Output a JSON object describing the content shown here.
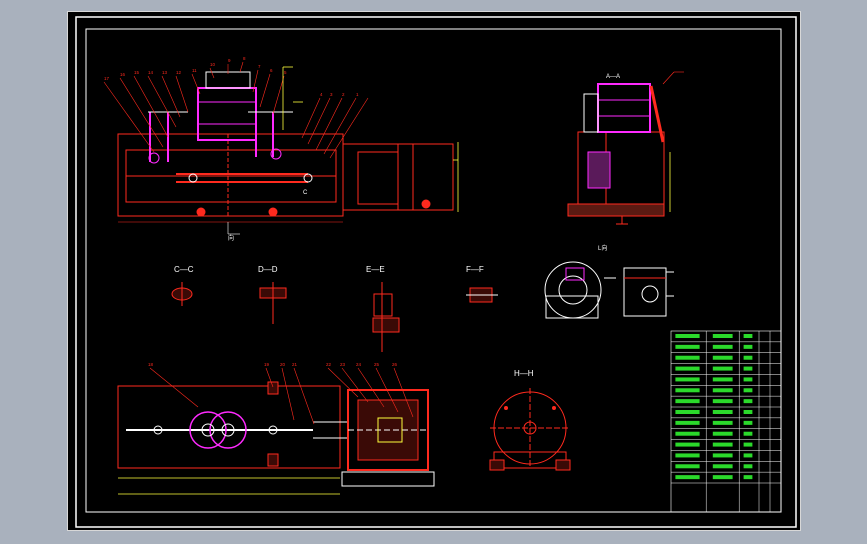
{
  "views": {
    "section_labels": [
      {
        "id": "cc",
        "text": "C—C"
      },
      {
        "id": "dd",
        "text": "D—D"
      },
      {
        "id": "ee",
        "text": "E—E"
      },
      {
        "id": "ff",
        "text": "F—F"
      },
      {
        "id": "hh",
        "text": "H—H"
      }
    ],
    "side_view_label": "A—A",
    "aux_view_label": "L向",
    "front_view_note": "向",
    "plan_view_note": "C"
  },
  "balloons": {
    "front_top": [
      "17",
      "16",
      "15",
      "14",
      "13",
      "12",
      "11",
      "10",
      "9",
      "8",
      "7",
      "6",
      "5",
      "4",
      "3",
      "2",
      "1"
    ],
    "bottom": [
      "18",
      "19",
      "20",
      "21",
      "22",
      "23",
      "24",
      "25",
      "26"
    ]
  },
  "title_block": {
    "rows": 14,
    "columns": 5
  },
  "colors": {
    "page_background": "#a9b1bd",
    "sheet": "#000000",
    "frame": "#ffffff",
    "part_red": "#ff2a1e",
    "part_magenta": "#ff2aff",
    "dimension_yellow": "#ffff3c",
    "text_green": "#33ff33"
  }
}
